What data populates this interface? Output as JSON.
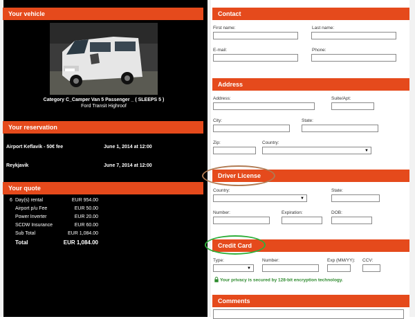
{
  "vehicle": {
    "header": "Your vehicle",
    "category": "Category C_Camper Van 5 Passenger _ ( SLEEPS 5 )",
    "model": "Ford Transit Highroof"
  },
  "reservation": {
    "header": "Your reservation",
    "pickup_location": "Airport Keflavik - 50€ fee",
    "pickup_date": "June 1, 2014 at 12:00",
    "dropoff_location": "Reykjavik",
    "dropoff_date": "June 7, 2014 at 12:00"
  },
  "quote": {
    "header": "Your quote",
    "rows": [
      {
        "qty": "6",
        "label": "Day(s) rental",
        "value": "EUR 954.00"
      },
      {
        "qty": "",
        "label": "Airport p/u Fee",
        "value": "EUR 50.00"
      },
      {
        "qty": "",
        "label": "Power Inverter",
        "value": "EUR 20.00"
      },
      {
        "qty": "",
        "label": "SCDW Insurance",
        "value": "EUR 60.00"
      },
      {
        "qty": "",
        "label": "Sub Total",
        "value": "EUR 1,084.00"
      }
    ],
    "total_label": "Total",
    "total_value": "EUR 1,084.00"
  },
  "contact": {
    "header": "Contact",
    "first_name_label": "First name:",
    "last_name_label": "Last name:",
    "email_label": "E-mail:",
    "phone_label": "Phone:"
  },
  "address": {
    "header": "Address",
    "address_label": "Address:",
    "suite_label": "Suite/Apt:",
    "city_label": "City:",
    "state_label": "State:",
    "zip_label": "Zip:",
    "country_label": "Country:"
  },
  "license": {
    "header": "Driver License",
    "country_label": "Country:",
    "state_label": "State:",
    "number_label": "Number:",
    "expiration_label": "Expiration:",
    "dob_label": "DOB:"
  },
  "credit_card": {
    "header": "Credit Card",
    "type_label": "Type:",
    "number_label": "Number:",
    "exp_label": "Exp (MM/YY):",
    "ccv_label": "CCV:",
    "privacy_text": "Your privacy is secured by 128-bit encryption technology."
  },
  "comments": {
    "header": "Comments"
  },
  "colors": {
    "header_orange": "#e54a1c",
    "license_oval": "#b07a52",
    "card_oval": "#2fae3a",
    "privacy_green": "#2e8b2e"
  }
}
